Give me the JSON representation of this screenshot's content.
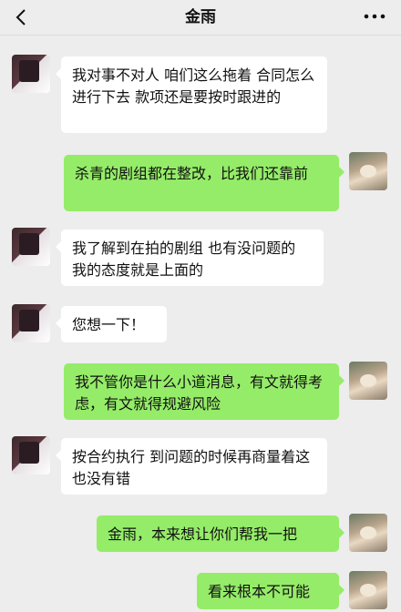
{
  "header": {
    "title": "金雨",
    "back_icon": "chevron-left-icon",
    "more_icon": "more-dots-icon"
  },
  "messages": [
    {
      "side": "in",
      "text": "我对事不对人 咱们这么拖着 合同怎么进行下去 款项还是要按时跟进的"
    },
    {
      "side": "out",
      "text": "杀青的剧组都在整改，比我们还靠前"
    },
    {
      "side": "in",
      "text": "我了解到在拍的剧组 也有没问题的 我的态度就是上面的"
    },
    {
      "side": "in",
      "text": "您想一下！"
    },
    {
      "side": "out",
      "text": "我不管你是什么小道消息，有文就得考虑，有文就得规避风险"
    },
    {
      "side": "in",
      "text": "按合约执行 到问题的时候再商量着这也没有错"
    },
    {
      "side": "out",
      "text": "金雨，本来想让你们帮我一把"
    },
    {
      "side": "out",
      "text": "看来根本不可能"
    }
  ],
  "colors": {
    "background": "#ededed",
    "incoming_bubble": "#ffffff",
    "outgoing_bubble": "#95ec69"
  }
}
